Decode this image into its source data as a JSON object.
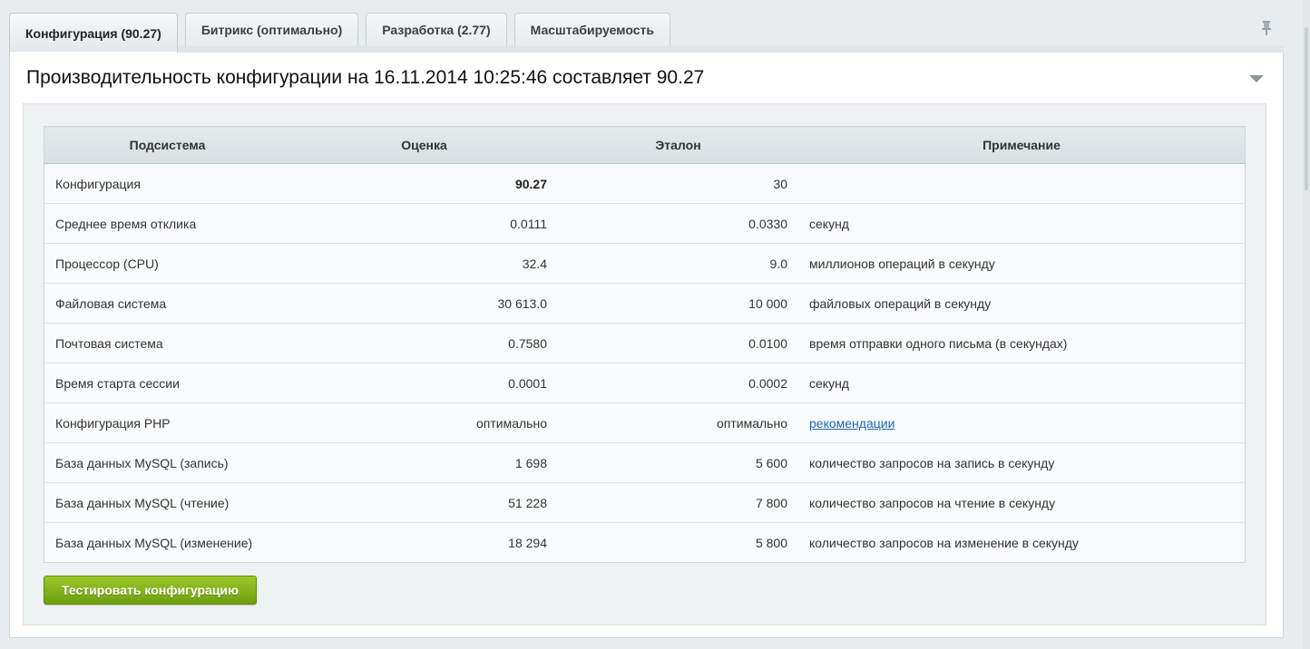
{
  "tabs": [
    {
      "label": "Конфигурация (90.27)",
      "active": true
    },
    {
      "label": "Битрикс (оптимально)",
      "active": false
    },
    {
      "label": "Разработка (2.77)",
      "active": false
    },
    {
      "label": "Масштабируемость",
      "active": false
    }
  ],
  "panel": {
    "title": "Производительность конфигурации на 16.11.2014 10:25:46 составляет 90.27"
  },
  "table": {
    "headers": [
      "Подсистема",
      "Оценка",
      "Эталон",
      "Примечание"
    ],
    "rows": [
      {
        "subsystem": "Конфигурация",
        "score": "90.27",
        "reference": "30",
        "note": ""
      },
      {
        "subsystem": "Среднее время отклика",
        "score": "0.0111",
        "reference": "0.0330",
        "note": "секунд"
      },
      {
        "subsystem": "Процессор (CPU)",
        "score": "32.4",
        "reference": "9.0",
        "note": "миллионов операций в секунду"
      },
      {
        "subsystem": "Файловая система",
        "score": "30 613.0",
        "reference": "10 000",
        "note": "файловых операций в секунду"
      },
      {
        "subsystem": "Почтовая система",
        "score": "0.7580",
        "reference": "0.0100",
        "note": "время отправки одного письма (в секундах)"
      },
      {
        "subsystem": "Время старта сессии",
        "score": "0.0001",
        "reference": "0.0002",
        "note": "секунд"
      },
      {
        "subsystem": "Конфигурация PHP",
        "score": "оптимально",
        "reference": "оптимально",
        "note": "рекомендации"
      },
      {
        "subsystem": "База данных MySQL (запись)",
        "score": "1 698",
        "reference": "5 600",
        "note": "количество запросов на запись в секунду"
      },
      {
        "subsystem": "База данных MySQL (чтение)",
        "score": "51 228",
        "reference": "7 800",
        "note": "количество запросов на чтение в секунду"
      },
      {
        "subsystem": "База данных MySQL (изменение)",
        "score": "18 294",
        "reference": "5 800",
        "note": "количество запросов на изменение в секунду"
      }
    ]
  },
  "actions": {
    "run_label": "Тестировать конфигурацию"
  },
  "colors": {
    "accent_green": "#7eaf16",
    "link_blue": "#2067b0"
  },
  "icons": {
    "pin": "pin-icon",
    "collapse": "chevron-down-icon"
  }
}
